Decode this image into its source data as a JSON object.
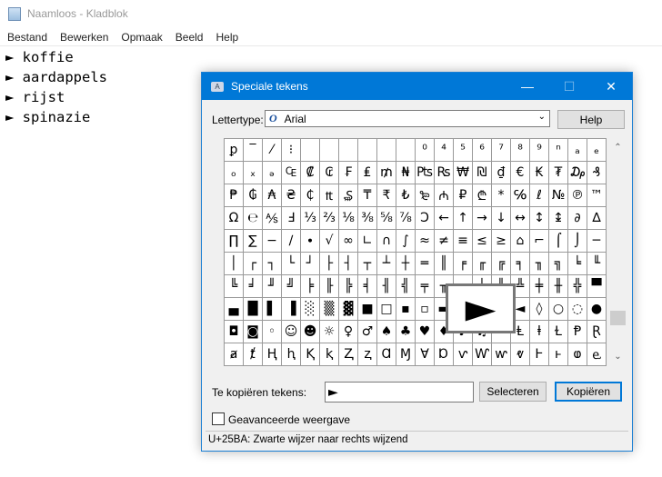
{
  "notepad": {
    "title": "Naamloos - Kladblok",
    "menu": [
      "Bestand",
      "Bewerken",
      "Opmaak",
      "Beeld",
      "Help"
    ],
    "lines": [
      "► koffie",
      "► aardappels",
      "► rijst",
      "► spinazie"
    ]
  },
  "dialog": {
    "title": "Speciale tekens",
    "minimize": "—",
    "maximize": "☐",
    "close": "✕",
    "font_label": "Lettertype:",
    "font_value": "Arial",
    "help_button": "Help",
    "grid_rows": [
      [
        "ꝑ",
        "‾",
        "⁄",
        "⁝",
        "",
        "",
        "",
        "",
        "",
        "",
        "⁰",
        "⁴",
        "⁵",
        "⁶",
        "⁷",
        "⁸",
        "⁹",
        "ⁿ",
        "ₐ",
        "ₑ"
      ],
      [
        "ₒ",
        "ₓ",
        "ₔ",
        "₠",
        "₡",
        "₢",
        "₣",
        "₤",
        "₥",
        "₦",
        "₧",
        "₨",
        "₩",
        "₪",
        "₫",
        "€",
        "₭",
        "₮",
        "₯",
        "₰"
      ],
      [
        "₱",
        "₲",
        "₳",
        "₴",
        "₵",
        "₶",
        "₷",
        "₸",
        "₹",
        "₺",
        "₻",
        "₼",
        "₽",
        "₾",
        "*",
        "℅",
        "ℓ",
        "№",
        "℗",
        "™"
      ],
      [
        "Ω",
        "℮",
        "⅍",
        "Ⅎ",
        "⅓",
        "⅔",
        "⅛",
        "⅜",
        "⅝",
        "⅞",
        "Ↄ",
        "←",
        "↑",
        "→",
        "↓",
        "↔",
        "↕",
        "↨",
        "∂",
        "∆"
      ],
      [
        "∏",
        "∑",
        "−",
        "∕",
        "∙",
        "√",
        "∞",
        "∟",
        "∩",
        "∫",
        "≈",
        "≠",
        "≡",
        "≤",
        "≥",
        "⌂",
        "⌐",
        "⌠",
        "⌡",
        "─"
      ],
      [
        "│",
        "┌",
        "┐",
        "└",
        "┘",
        "├",
        "┤",
        "┬",
        "┴",
        "┼",
        "═",
        "║",
        "╒",
        "╓",
        "╔",
        "╕",
        "╖",
        "╗",
        "╘",
        "╙"
      ],
      [
        "╚",
        "╛",
        "╜",
        "╝",
        "╞",
        "╟",
        "╠",
        "╡",
        "╢",
        "╣",
        "╤",
        "╥",
        "╦",
        "╧",
        "╨",
        "╩",
        "╪",
        "╫",
        "╬",
        "▀"
      ],
      [
        "▄",
        "█",
        "▌",
        "▐",
        "░",
        "▒",
        "▓",
        "■",
        "□",
        "▪",
        "▫",
        "▬",
        "▲",
        "►",
        "▼",
        "◄",
        "◊",
        "○",
        "◌",
        "●"
      ],
      [
        "◘",
        "◙",
        "◦",
        "☺",
        "☻",
        "☼",
        "♀",
        "♂",
        "♠",
        "♣",
        "♥",
        "♦",
        "♪",
        "♫",
        "ꜗ",
        "Ⱡ",
        "ⱡ",
        "Ɫ",
        "Ᵽ",
        "Ɽ"
      ],
      [
        "ⱥ",
        "ⱦ",
        "Ⱨ",
        "ⱨ",
        "Ⱪ",
        "ⱪ",
        "Ⱬ",
        "ⱬ",
        "Ɑ",
        "Ɱ",
        "Ɐ",
        "Ɒ",
        "ⱱ",
        "Ⱳ",
        "ⱳ",
        "ⱴ",
        "Ⱶ",
        "ⱶ",
        "ⱷ",
        "ⱸ"
      ]
    ],
    "magnified_char": "►",
    "copy_label": "Te kopiëren tekens:",
    "copy_value": "►",
    "select_button": "Selecteren",
    "copy_button": "Kopiëren",
    "advanced_label": "Geavanceerde weergave",
    "advanced_checked": false,
    "status": "U+25BA: Zwarte wijzer naar rechts wijzend"
  }
}
